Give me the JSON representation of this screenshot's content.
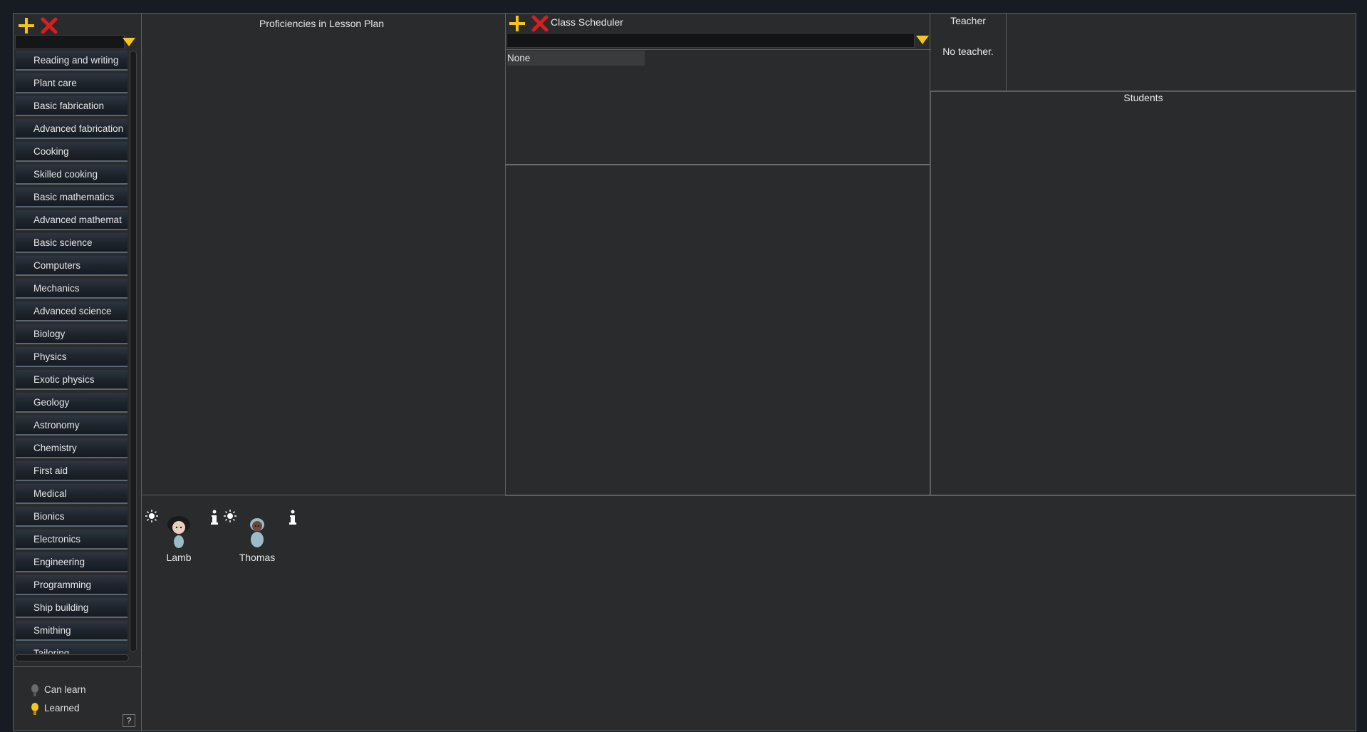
{
  "left_panel": {
    "search_value": "",
    "proficiencies": [
      "Reading and writing",
      "Plant care",
      "Basic fabrication",
      "Advanced fabrication",
      "Cooking",
      "Skilled cooking",
      "Basic mathematics",
      "Advanced mathemat",
      "Basic science",
      "Computers",
      "Mechanics",
      "Advanced science",
      "Biology",
      "Physics",
      "Exotic physics",
      "Geology",
      "Astronomy",
      "Chemistry",
      "First aid",
      "Medical",
      "Bionics",
      "Electronics",
      "Engineering",
      "Programming",
      "Ship building",
      "Smithing",
      "Tailoring"
    ],
    "legend": {
      "can_learn": "Can learn",
      "learned": "Learned",
      "help": "?"
    }
  },
  "lesson_plan": {
    "title": "Proficiencies in Lesson Plan"
  },
  "scheduler": {
    "title": "Class Scheduler",
    "select_value": "",
    "list_items": [
      "None"
    ]
  },
  "teacher": {
    "title": "Teacher",
    "empty": "No teacher."
  },
  "students": {
    "title": "Students"
  },
  "pawns": [
    {
      "name": "Lamb"
    },
    {
      "name": "Thomas"
    }
  ],
  "colors": {
    "accent_yellow": "#f5c518",
    "close_red": "#d42020",
    "bg": "#2a2b2d"
  },
  "icons": [
    "plus-icon",
    "close-icon",
    "chevron-down-icon",
    "lightbulb-icon",
    "info-icon",
    "bulb-off-icon",
    "bulb-on-icon"
  ]
}
